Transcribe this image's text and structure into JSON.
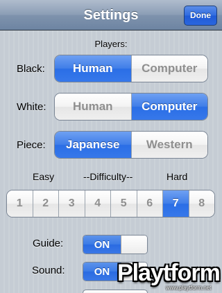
{
  "navbar": {
    "title": "Settings",
    "done_label": "Done"
  },
  "players": {
    "section_label": "Players:",
    "black": {
      "label": "Black:",
      "options": [
        "Human",
        "Computer"
      ],
      "selected": "Human"
    },
    "white": {
      "label": "White:",
      "options": [
        "Human",
        "Computer"
      ],
      "selected": "Computer"
    },
    "piece": {
      "label": "Piece:",
      "options": [
        "Japanese",
        "Western"
      ],
      "selected": "Japanese"
    }
  },
  "difficulty": {
    "easy_label": "Easy",
    "title_label": "--Difficulty--",
    "hard_label": "Hard",
    "levels": [
      "1",
      "2",
      "3",
      "4",
      "5",
      "6",
      "7",
      "8"
    ],
    "selected": "7"
  },
  "options": {
    "guide": {
      "label": "Guide:",
      "state": "ON"
    },
    "sound": {
      "label": "Sound:",
      "state": "ON"
    }
  },
  "watermark": {
    "brand": "Playtform",
    "url": "www.playtform.net"
  },
  "colors": {
    "accent_blue": "#3a78e8",
    "navbar": "#7f93ad"
  }
}
